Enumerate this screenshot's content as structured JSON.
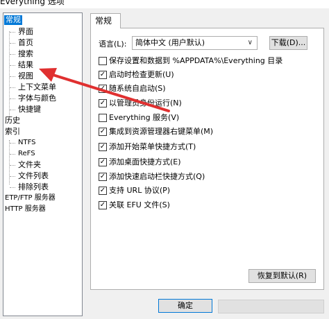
{
  "window": {
    "title": "Everything 选项"
  },
  "tree": {
    "items": [
      {
        "label": "常规"
      },
      {
        "label": "界面"
      },
      {
        "label": "首页"
      },
      {
        "label": "搜索"
      },
      {
        "label": "结果"
      },
      {
        "label": "视图"
      },
      {
        "label": "上下文菜单"
      },
      {
        "label": "字体与颜色"
      },
      {
        "label": "快捷键"
      },
      {
        "label": "历史"
      },
      {
        "label": "索引"
      },
      {
        "label": "NTFS"
      },
      {
        "label": "ReFS"
      },
      {
        "label": "文件夹"
      },
      {
        "label": "文件列表"
      },
      {
        "label": "排除列表"
      },
      {
        "label": "ETP/FTP 服务器"
      },
      {
        "label": "HTTP 服务器"
      }
    ]
  },
  "tab": {
    "label": "常规"
  },
  "language": {
    "label": "语言(L):",
    "value": "简体中文 (用户默认)",
    "download_label": "下载(D)..."
  },
  "options": [
    {
      "label": "保存设置和数据到 %APPDATA%\\Everything 目录",
      "checked": false
    },
    {
      "label": "启动时检查更新(U)",
      "checked": true
    },
    {
      "label": "随系统自启动(S)",
      "checked": true
    },
    {
      "label": "以管理员身份运行(N)",
      "checked": true
    },
    {
      "label": "Everything 服务(V)",
      "checked": false
    },
    {
      "label": "集成到资源管理器右键菜单(M)",
      "checked": true
    },
    {
      "label": "添加开始菜单快捷方式(T)",
      "checked": true
    },
    {
      "label": "添加桌面快捷方式(E)",
      "checked": true
    },
    {
      "label": "添加快速启动栏快捷方式(Q)",
      "checked": true
    },
    {
      "label": "支持 URL 协议(P)",
      "checked": true
    },
    {
      "label": "关联 EFU 文件(S)",
      "checked": true
    }
  ],
  "buttons": {
    "restore_label": "恢复到默认(R)",
    "ok_label": "确定"
  },
  "colors": {
    "selection": "#0078d7",
    "annotation_arrow": "#e03030"
  },
  "annotation": {
    "icon": "red-arrow-icon"
  }
}
